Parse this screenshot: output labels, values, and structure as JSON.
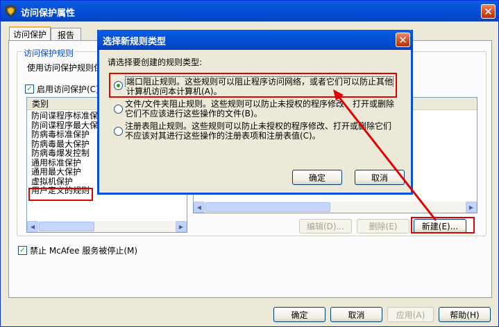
{
  "main_window": {
    "title": "访问保护属性",
    "close_glyph": "✕",
    "icon": "shield-icon",
    "tabs": [
      {
        "label": "访问保护",
        "active": true
      },
      {
        "label": "报告",
        "active": false
      }
    ],
    "group_title": "访问保护规则",
    "description": "使用访问保护规则保",
    "enable_checkbox": {
      "label": "启用访问保护(C)",
      "checked": true
    },
    "categories": {
      "header": "类别",
      "items": [
        "防间谍程序标准保",
        "防间谍程序最大保",
        "防病毒标准保护",
        "防病毒最大保护",
        "防病毒爆发控制",
        "通用标准保护",
        "通用最大保护",
        "虚拟机保护",
        "用户定义的规则"
      ],
      "highlighted": "用户定义的规则"
    },
    "rule_buttons": {
      "edit": "编辑(D)...",
      "delete": "删除(E)",
      "new": "新建(E)..."
    },
    "mcafee_checkbox": {
      "label": "禁止 McAfee 服务被停止(M)",
      "checked": true
    },
    "bottom_buttons": {
      "ok": "确定",
      "cancel": "取消",
      "apply": "应用(A)",
      "help": "帮助(H)"
    }
  },
  "dialog": {
    "title": "选择新规则类型",
    "close_glyph": "✕",
    "prompt": "请选择要创建的规则类型:",
    "options": [
      {
        "line1": "端口阻止规则。这些规则可以阻止程序访问网络，或者它们可以防止其他",
        "line2": "计算机访问本计算机(A)。",
        "selected": true
      },
      {
        "line1": "文件/文件夹阻止规则。这些规则可以防止未授权的程序修改、打开或删除",
        "line2": "它们不应该进行这些操作的文件(B)。",
        "selected": false
      },
      {
        "line1": "注册表阻止规则。这些规则可以防止未授权的程序修改、打开或删除它们",
        "line2": "不应该对其进行这些操作的注册表项和注册表值(C)。",
        "selected": false
      }
    ],
    "ok": "确定",
    "cancel": "取消"
  },
  "colors": {
    "annotation_red": "#e00000",
    "xp_blue": "#0550d8"
  }
}
